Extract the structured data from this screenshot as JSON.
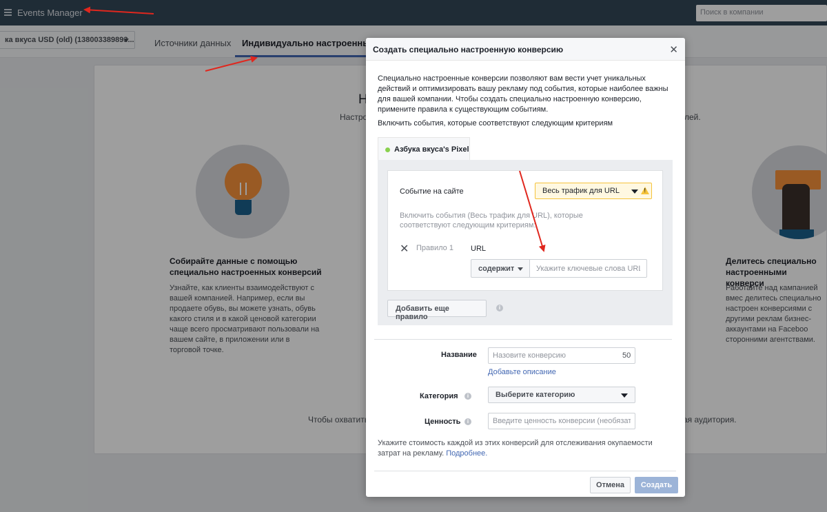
{
  "topbar": {
    "app_title": "Events Manager",
    "search_placeholder": "Поиск в компании"
  },
  "subnav": {
    "account": "ка вкуса USD (old) (138003389893...",
    "tabs": [
      {
        "label": "Источники данных"
      },
      {
        "label": "Индивидуально настроенные"
      }
    ]
  },
  "background": {
    "heading_fragment": "Н",
    "subtext_left": "Настро",
    "subtext_right": "лей.",
    "left_feature": {
      "title": "Собирайте данные с помощью специально настроенных конверсий",
      "desc": "Узнайте, как клиенты взаимодействуют с вашей компанией. Например, если вы продаете обувь, вы можете узнать, обувь какого стиля и в какой ценовой категории чаще всего просматривают пользовали на вашем сайте, в приложении или в торговой точке."
    },
    "right_feature": {
      "title": "Делитесь специально настроенными конверси",
      "desc": "Работайте над кампанией вмес делитесь специально настроен конверсиями с другими реклам бизнес-аккаунтами на Faceboo сторонними агентствами."
    },
    "bottom_left": "Чтобы охватить л",
    "bottom_right": "ая аудитория."
  },
  "modal": {
    "title": "Создать специально настроенную конверсию",
    "intro": "Специально настроенные конверсии позволяют вам вести учет уникальных действий и оптимизировать вашу рекламу под события, которые наиболее важны для вашей компании. Чтобы создать специально настроенную конверсию, примените правила к существующим событиям.",
    "criteria_label": "Включить события, которые соответствуют следующим критериям",
    "pixel_tab": "Азбука вкуса's Pixel",
    "event_label": "Событие на сайте",
    "event_value": "Весь трафик для URL",
    "include_text": "Включить события (Весь трафик для URL), которые соответствуют следующим критериям:",
    "rule_label": "Правило 1",
    "url_label": "URL",
    "operator": "содержит",
    "url_placeholder": "Укажите ключевые слова URL",
    "add_rule": "Добавить еще правило",
    "name_label": "Название",
    "name_placeholder": "Назовите конверсию",
    "name_count": "50",
    "add_desc": "Добавьте описание",
    "category_label": "Категория",
    "category_value": "Выберите категорию",
    "value_label": "Ценность",
    "value_placeholder": "Введите ценность конверсии (необязатель",
    "cost_note": "Укажите стоимость каждой из этих конверсий для отслеживания окупаемости затрат на рекламу.",
    "cost_link": "Подробнее.",
    "cancel": "Отмена",
    "create": "Создать"
  },
  "colors": {
    "topbar": "#334758",
    "accent": "#4267b2",
    "annotation": "#e0271e",
    "warning": "#f5c33b"
  }
}
